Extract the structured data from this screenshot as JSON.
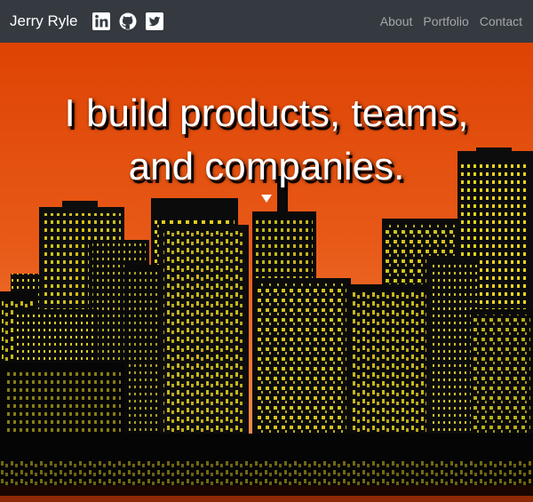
{
  "navbar": {
    "brand": "Jerry Ryle",
    "social": [
      {
        "icon": "linkedin-icon"
      },
      {
        "icon": "github-icon"
      },
      {
        "icon": "twitter-icon"
      }
    ],
    "links": [
      {
        "label": "About"
      },
      {
        "label": "Portfolio"
      },
      {
        "label": "Contact"
      }
    ]
  },
  "hero": {
    "headline_line1": "I build products, teams,",
    "headline_line2": "and companies.",
    "scroll_icon": "caret-down-icon"
  },
  "colors": {
    "navbar_bg": "#343a40",
    "sky_top": "#e34a06",
    "sky_bottom": "#f07a3a",
    "window_light": "#f5e21e",
    "building": "#0a0a0a"
  }
}
